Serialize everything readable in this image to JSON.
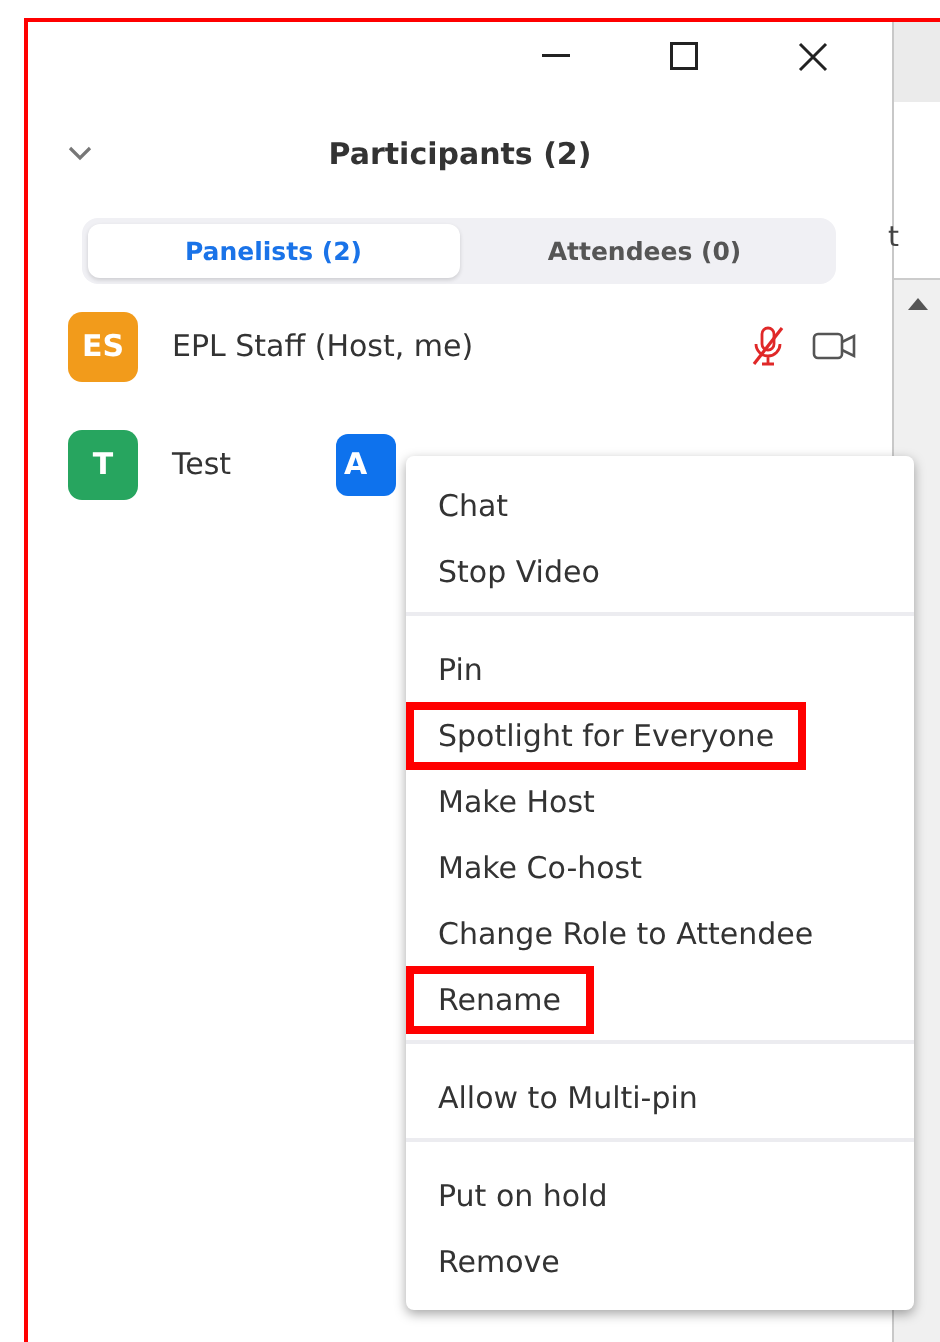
{
  "header": {
    "title": "Participants (2)"
  },
  "tabs": [
    {
      "label": "Panelists (2)",
      "selected": true
    },
    {
      "label": "Attendees (0)",
      "selected": false
    }
  ],
  "participants": [
    {
      "initials": "ES",
      "name": "EPL Staff (Host, me)",
      "color": "#f29b1b",
      "muted": true,
      "video": true
    },
    {
      "initials": "T",
      "name": "Test",
      "color": "#27a55f",
      "button": "A"
    }
  ],
  "background_window": {
    "text": "t"
  },
  "context_menu": {
    "groups": [
      [
        {
          "label": "Chat",
          "highlighted": false
        },
        {
          "label": "Stop Video",
          "highlighted": false
        }
      ],
      [
        {
          "label": "Pin",
          "highlighted": false
        },
        {
          "label": "Spotlight for Everyone",
          "highlighted": true
        },
        {
          "label": "Make Host",
          "highlighted": false
        },
        {
          "label": "Make Co-host",
          "highlighted": false
        },
        {
          "label": "Change Role to Attendee",
          "highlighted": false
        },
        {
          "label": "Rename",
          "highlighted": true
        }
      ],
      [
        {
          "label": "Allow to Multi-pin",
          "highlighted": false
        }
      ],
      [
        {
          "label": "Put on hold",
          "highlighted": false
        },
        {
          "label": "Remove",
          "highlighted": false
        }
      ]
    ]
  }
}
